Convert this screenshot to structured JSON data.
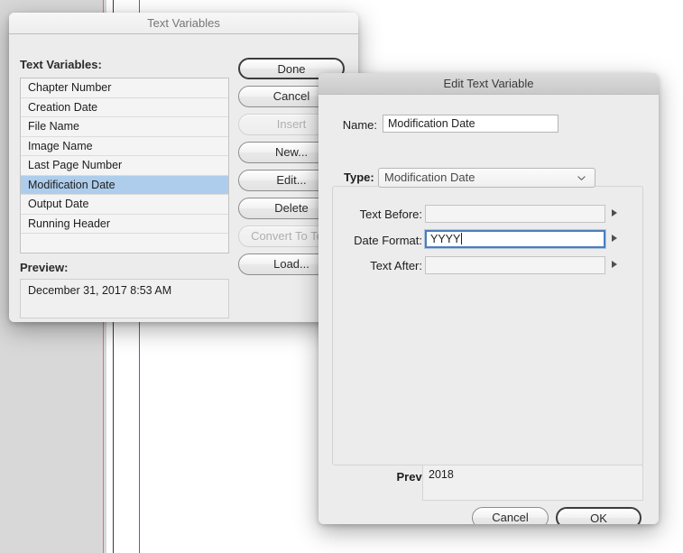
{
  "document_background": {
    "pasteboard_color": "#d8d8d8",
    "page_color": "#ffffff",
    "guides": [
      {
        "name": "margin-guide-red",
        "color": "#e8677f"
      },
      {
        "name": "page-edge-black",
        "color": "#3a3a3a"
      },
      {
        "name": "column-guide-violet",
        "color": "#8b3fd4"
      }
    ]
  },
  "text_variables_dialog": {
    "title": "Text Variables",
    "list_label": "Text Variables:",
    "items": [
      "Chapter Number",
      "Creation Date",
      "File Name",
      "Image Name",
      "Last Page Number",
      "Modification Date",
      "Output Date",
      "Running Header"
    ],
    "selected_item": "Modification Date",
    "preview_label": "Preview:",
    "preview_value": "December 31, 2017 8:53 AM",
    "buttons": [
      {
        "label": "Done",
        "state": "default"
      },
      {
        "label": "Cancel",
        "state": "enabled"
      },
      {
        "label": "Insert",
        "state": "disabled"
      },
      {
        "label": "New...",
        "state": "enabled"
      },
      {
        "label": "Edit...",
        "state": "enabled"
      },
      {
        "label": "Delete",
        "state": "enabled"
      },
      {
        "label": "Convert To Text",
        "state": "disabled"
      },
      {
        "label": "Load...",
        "state": "enabled"
      }
    ]
  },
  "edit_text_variable_dialog": {
    "title": "Edit Text Variable",
    "name_label": "Name:",
    "name_value": "Modification Date",
    "type_label": "Type:",
    "type_value": "Modification Date",
    "type_chevron_icon": "chevron-down-icon",
    "fields": [
      {
        "label": "Text Before:",
        "value": "",
        "focused": false,
        "disclosure_icon": "disclosure-triangle-icon"
      },
      {
        "label": "Date Format:",
        "value": "YYYY",
        "focused": true,
        "disclosure_icon": "disclosure-triangle-icon"
      },
      {
        "label": "Text After:",
        "value": "",
        "focused": false,
        "disclosure_icon": "disclosure-triangle-icon"
      }
    ],
    "preview_label": "Preview:",
    "preview_value": "2018",
    "cancel_label": "Cancel",
    "ok_label": "OK",
    "accent_focus_color": "#4a7ebb",
    "selection_color": "#aecdec"
  }
}
